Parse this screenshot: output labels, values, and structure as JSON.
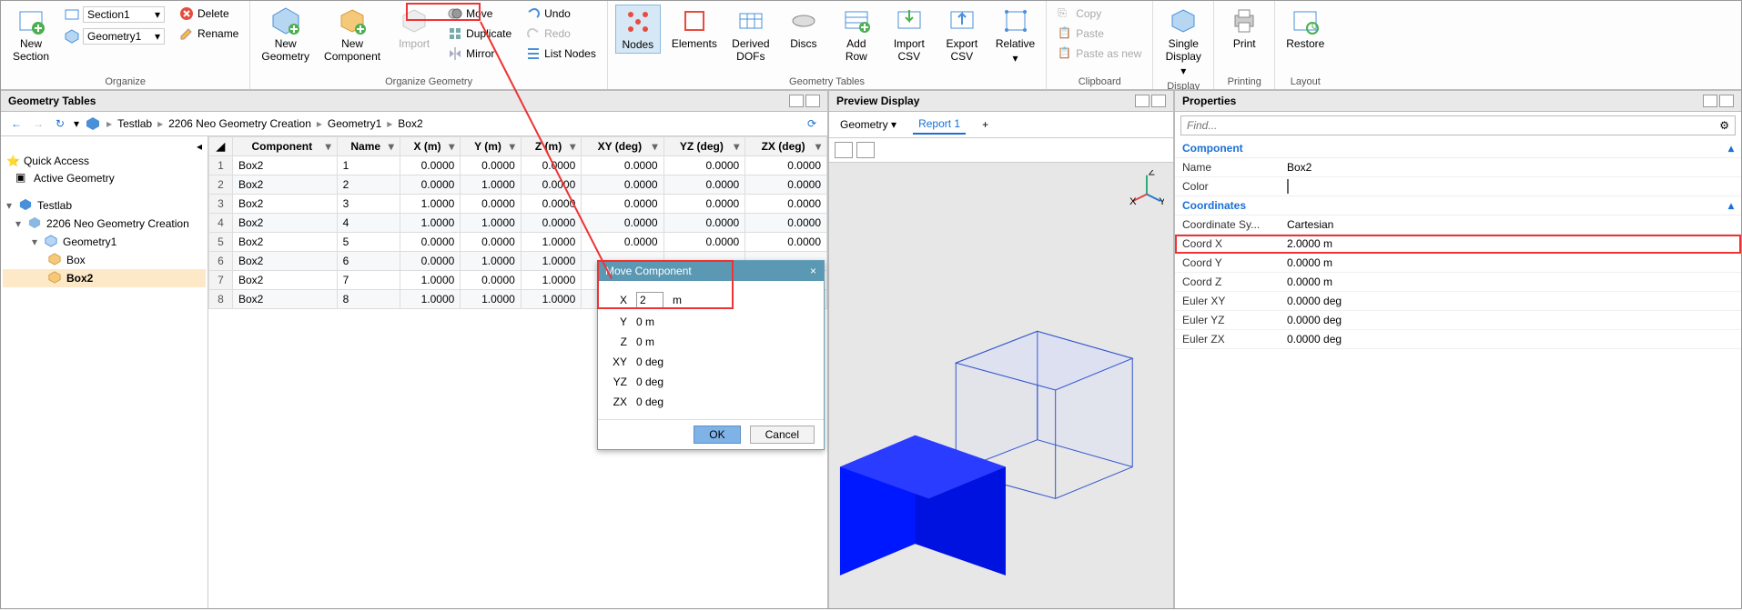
{
  "ribbon": {
    "organize": {
      "title": "Organize",
      "new_section": "New\nSection",
      "section_dd": "Section1",
      "geometry_dd": "Geometry1",
      "delete": "Delete",
      "rename": "Rename"
    },
    "organize_geometry": {
      "title": "Organize Geometry",
      "new_geometry": "New\nGeometry",
      "new_component": "New\nComponent",
      "import": "Import",
      "move": "Move",
      "duplicate": "Duplicate",
      "mirror": "Mirror",
      "undo": "Undo",
      "redo": "Redo",
      "list_nodes": "List Nodes"
    },
    "geometry_tables": {
      "title": "Geometry Tables",
      "nodes": "Nodes",
      "elements": "Elements",
      "derived_dofs": "Derived\nDOFs",
      "discs": "Discs",
      "add_row": "Add\nRow",
      "import_csv": "Import\nCSV",
      "export_csv": "Export\nCSV",
      "relative": "Relative"
    },
    "clipboard": {
      "title": "Clipboard",
      "copy": "Copy",
      "paste": "Paste",
      "paste_as_new": "Paste as new"
    },
    "display": {
      "title": "Display",
      "single_display": "Single\nDisplay"
    },
    "printing": {
      "title": "Printing",
      "print": "Print"
    },
    "layout": {
      "title": "Layout",
      "restore": "Restore"
    }
  },
  "panels": {
    "geometry_tables": "Geometry Tables",
    "preview_display": "Preview Display",
    "properties": "Properties"
  },
  "breadcrumb": {
    "root": "Testlab",
    "proj": "2206 Neo Geometry Creation",
    "geom": "Geometry1",
    "comp": "Box2"
  },
  "tree": {
    "quick_access": "Quick Access",
    "active_geometry": "Active Geometry",
    "testlab": "Testlab",
    "project": "2206 Neo Geometry Creation",
    "geometry1": "Geometry1",
    "box": "Box",
    "box2": "Box2",
    "collapse": "◂"
  },
  "table": {
    "headers": {
      "component": "Component",
      "name": "Name",
      "x": "X (m)",
      "y": "Y (m)",
      "z": "Z (m)",
      "xy": "XY (deg)",
      "yz": "YZ (deg)",
      "zx": "ZX (deg)"
    },
    "rows": [
      {
        "n": "1",
        "comp": "Box2",
        "name": "1",
        "x": "0.0000",
        "y": "0.0000",
        "z": "0.0000",
        "xy": "0.0000",
        "yz": "0.0000",
        "zx": "0.0000"
      },
      {
        "n": "2",
        "comp": "Box2",
        "name": "2",
        "x": "0.0000",
        "y": "1.0000",
        "z": "0.0000",
        "xy": "0.0000",
        "yz": "0.0000",
        "zx": "0.0000"
      },
      {
        "n": "3",
        "comp": "Box2",
        "name": "3",
        "x": "1.0000",
        "y": "0.0000",
        "z": "0.0000",
        "xy": "0.0000",
        "yz": "0.0000",
        "zx": "0.0000"
      },
      {
        "n": "4",
        "comp": "Box2",
        "name": "4",
        "x": "1.0000",
        "y": "1.0000",
        "z": "0.0000",
        "xy": "0.0000",
        "yz": "0.0000",
        "zx": "0.0000"
      },
      {
        "n": "5",
        "comp": "Box2",
        "name": "5",
        "x": "0.0000",
        "y": "0.0000",
        "z": "1.0000",
        "xy": "0.0000",
        "yz": "0.0000",
        "zx": "0.0000"
      },
      {
        "n": "6",
        "comp": "Box2",
        "name": "6",
        "x": "0.0000",
        "y": "1.0000",
        "z": "1.0000",
        "xy": "",
        "yz": "",
        "zx": ""
      },
      {
        "n": "7",
        "comp": "Box2",
        "name": "7",
        "x": "1.0000",
        "y": "0.0000",
        "z": "1.0000",
        "xy": "",
        "yz": "",
        "zx": ""
      },
      {
        "n": "8",
        "comp": "Box2",
        "name": "8",
        "x": "1.0000",
        "y": "1.0000",
        "z": "1.0000",
        "xy": "",
        "yz": "",
        "zx": ""
      }
    ]
  },
  "preview_tabs": {
    "geometry": "Geometry",
    "report": "Report 1",
    "add": "+"
  },
  "axis": {
    "x": "X",
    "y": "Y",
    "z": "Z"
  },
  "dialog": {
    "title": "Move Component",
    "x_label": "X",
    "x_value": "2",
    "x_unit": "m",
    "y_label": "Y",
    "y_value": "0 m",
    "z_label": "Z",
    "z_value": "0 m",
    "xy_label": "XY",
    "xy_value": "0 deg",
    "yz_label": "YZ",
    "yz_value": "0 deg",
    "zx_label": "ZX",
    "zx_value": "0 deg",
    "ok": "OK",
    "cancel": "Cancel",
    "close": "×"
  },
  "properties": {
    "search_placeholder": "Find...",
    "section_component": "Component",
    "name_k": "Name",
    "name_v": "Box2",
    "color_k": "Color",
    "section_coordinates": "Coordinates",
    "coordsys_k": "Coordinate Sy...",
    "coordsys_v": "Cartesian",
    "coordx_k": "Coord X",
    "coordx_v": "2.0000 m",
    "coordy_k": "Coord Y",
    "coordy_v": "0.0000 m",
    "coordz_k": "Coord Z",
    "coordz_v": "0.0000 m",
    "eulerxy_k": "Euler XY",
    "eulerxy_v": "0.0000 deg",
    "euleryz_k": "Euler YZ",
    "euleryz_v": "0.0000 deg",
    "eulerzx_k": "Euler ZX",
    "eulerzx_v": "0.0000 deg",
    "caret": "▴"
  }
}
